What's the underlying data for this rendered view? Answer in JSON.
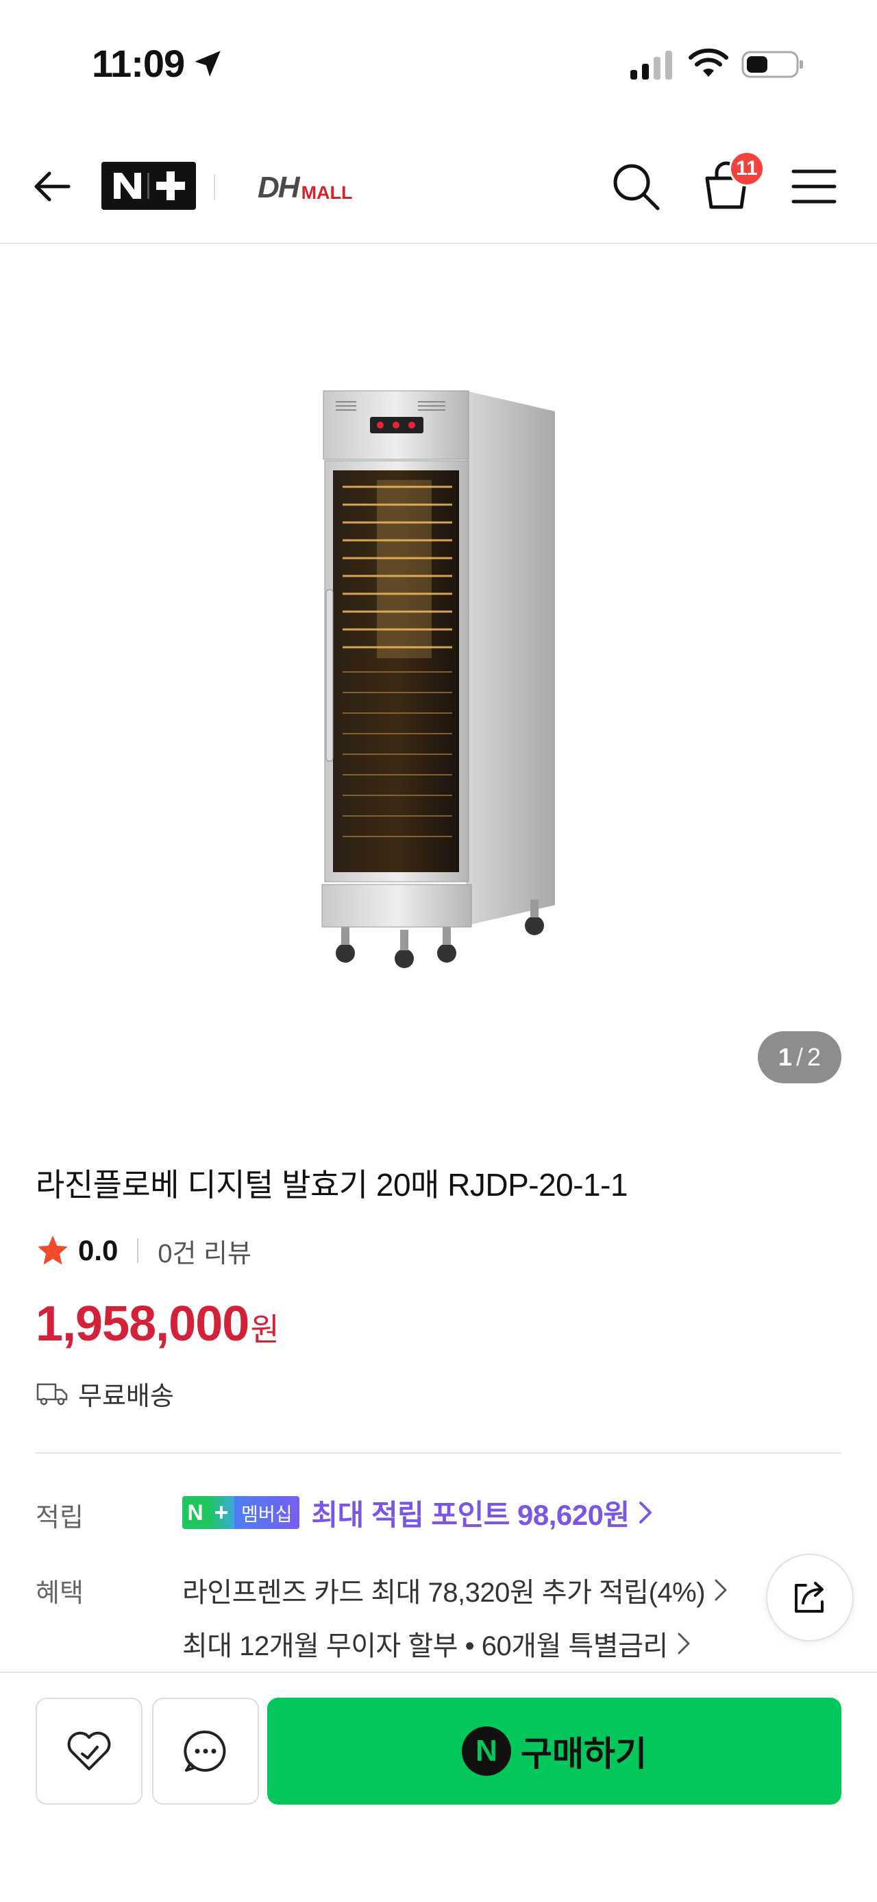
{
  "status_bar": {
    "time": "11:09"
  },
  "header": {
    "brand_logo": "N+",
    "store_logo_dh": "DH",
    "store_logo_mall": "MALL",
    "cart_count": "11"
  },
  "gallery": {
    "current": "1",
    "separator": "/",
    "total": "2"
  },
  "product": {
    "title": "라진플로베 디지털 발효기 20매 RJDP-20-1-1",
    "rating": "0.0",
    "review_count": "0건 리뷰",
    "price": "1,958,000",
    "price_unit": "원",
    "shipping": "무료배송"
  },
  "points": {
    "label": "적립",
    "badge_n": "N",
    "badge_plus": "+",
    "badge_text": "멤버십",
    "text": "최대 적립 포인트 98,620원"
  },
  "benefits": {
    "label": "혜택",
    "lines": [
      "라인프렌즈 카드 최대 78,320원 추가 적립(4%)",
      "최대 12개월 무이자 할부 • 60개월 특별금리"
    ]
  },
  "bottom_bar": {
    "npay_mark": "N",
    "buy_label": "구매하기"
  },
  "colors": {
    "price": "#d4213a",
    "points": "#7b55e8",
    "buy_button": "#03c75a",
    "cart_badge": "#f3423b",
    "rating_star": "#f04a2b"
  }
}
